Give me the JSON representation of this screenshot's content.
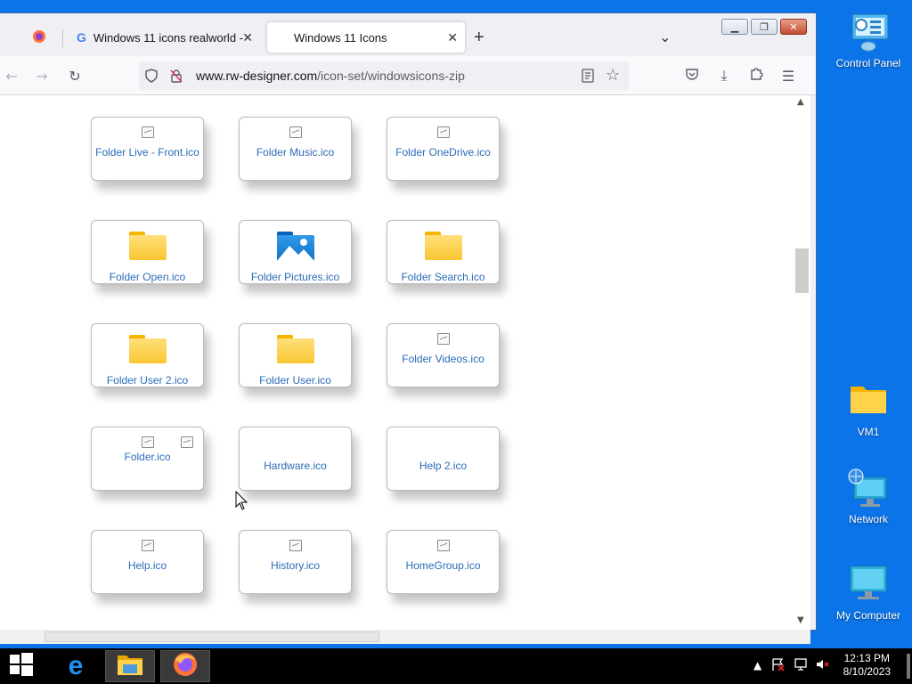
{
  "desktop": {
    "icons": [
      {
        "label": "Control Panel"
      },
      {
        "label": "VM1"
      },
      {
        "label": "Network"
      },
      {
        "label": "My Computer"
      }
    ]
  },
  "browser": {
    "tabs": [
      {
        "label": "Windows 11 icons realworld - G"
      },
      {
        "label": "Windows 11 Icons"
      }
    ],
    "new_tab": "+",
    "tab_list": "⌄",
    "url_host": "www.rw-designer.com",
    "url_path": "/icon-set/windowsicons-zip"
  },
  "icons": [
    {
      "name": "Folder Live - Front.ico",
      "preview": "broken"
    },
    {
      "name": "Folder Music.ico",
      "preview": "broken"
    },
    {
      "name": "Folder OneDrive.ico",
      "preview": "broken"
    },
    {
      "name": "Folder Open.ico",
      "preview": "folder"
    },
    {
      "name": "Folder Pictures.ico",
      "preview": "pictures"
    },
    {
      "name": "Folder Search.ico",
      "preview": "folder"
    },
    {
      "name": "Folder User 2.ico",
      "preview": "folder"
    },
    {
      "name": "Folder User.ico",
      "preview": "folder"
    },
    {
      "name": "Folder Videos.ico",
      "preview": "broken"
    },
    {
      "name": "Folder.ico",
      "preview": "broken2"
    },
    {
      "name": "Hardware.ico",
      "preview": "none"
    },
    {
      "name": "Help 2.ico",
      "preview": "none"
    },
    {
      "name": "Help.ico",
      "preview": "broken"
    },
    {
      "name": "History.ico",
      "preview": "broken"
    },
    {
      "name": "HomeGroup.ico",
      "preview": "broken"
    }
  ],
  "taskbar": {
    "time": "12:13 PM",
    "date": "8/10/2023"
  }
}
